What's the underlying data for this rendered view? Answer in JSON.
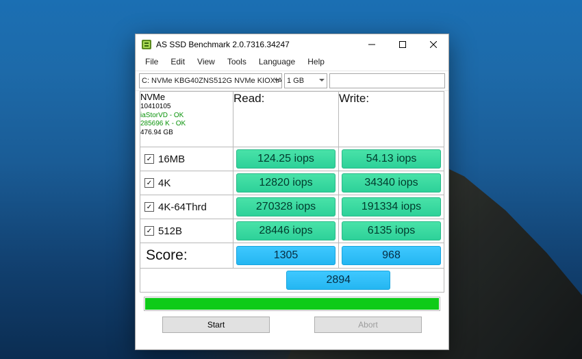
{
  "window": {
    "title": "AS SSD Benchmark 2.0.7316.34247"
  },
  "menu": {
    "file": "File",
    "edit": "Edit",
    "view": "View",
    "tools": "Tools",
    "language": "Language",
    "help": "Help"
  },
  "controls": {
    "drive": "C: NVMe KBG40ZNS512G NVMe KIOXIA",
    "size": "1 GB",
    "input_value": ""
  },
  "info": {
    "name": "NVMe",
    "id": "10410105",
    "driver": "iaStorVD - OK",
    "align": "285696 K - OK",
    "capacity": "476.94 GB"
  },
  "headers": {
    "read": "Read:",
    "write": "Write:"
  },
  "rows": [
    {
      "label": "16MB",
      "checked": true,
      "read": "124.25 iops",
      "write": "54.13 iops"
    },
    {
      "label": "4K",
      "checked": true,
      "read": "12820 iops",
      "write": "34340 iops"
    },
    {
      "label": "4K-64Thrd",
      "checked": true,
      "read": "270328 iops",
      "write": "191334 iops"
    },
    {
      "label": "512B",
      "checked": true,
      "read": "28446 iops",
      "write": "6135 iops"
    }
  ],
  "score": {
    "label": "Score:",
    "read": "1305",
    "write": "968",
    "total": "2894"
  },
  "buttons": {
    "start": "Start",
    "abort": "Abort"
  }
}
